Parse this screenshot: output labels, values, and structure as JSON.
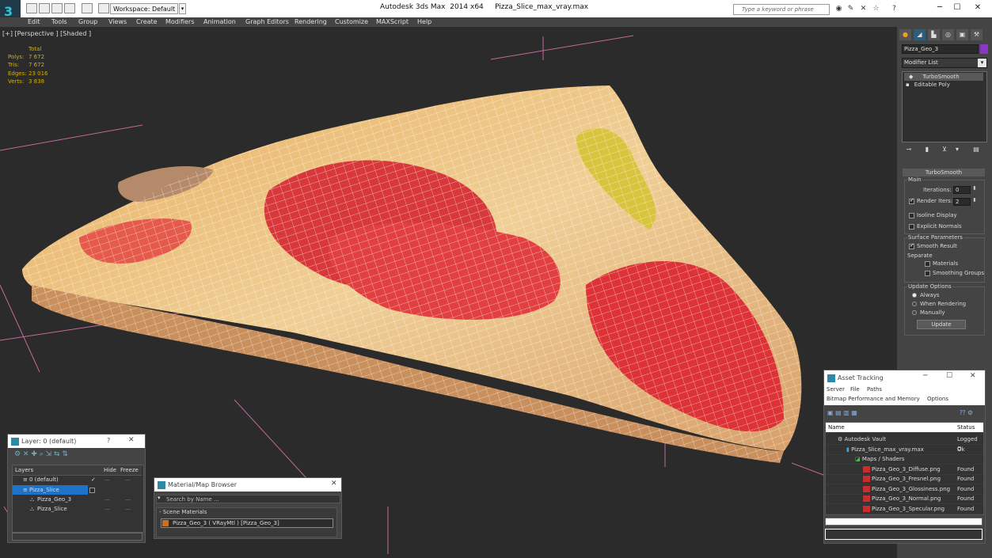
{
  "titlebar": {
    "workspace": "Workspace: Default",
    "app_title": "Autodesk 3ds Max  2014 x64     Pizza_Slice_max_vray.max",
    "search_placeholder": "Type a keyword or phrase"
  },
  "menu": [
    "Edit",
    "Tools",
    "Group",
    "Views",
    "Create",
    "Modifiers",
    "Animation",
    "Graph Editors",
    "Rendering",
    "Customize",
    "MAXScript",
    "Help"
  ],
  "viewport": {
    "label": "[+] [Perspective ] [Shaded ]",
    "stats": {
      "header": "Total",
      "polys_label": "Polys:",
      "polys": "7 672",
      "tris_label": "Tris:",
      "tris": "7 672",
      "edges_label": "Edges:",
      "edges": "23 016",
      "verts_label": "Verts:",
      "verts": "3 838"
    }
  },
  "command_panel": {
    "object_name": "Pizza_Geo_3",
    "object_color": "#8a38c4",
    "modifier_list": "Modifier List",
    "stack": [
      "TurboSmooth",
      "Editable Poly"
    ],
    "rollout_title": "TurboSmooth",
    "main_label": "Main",
    "iterations_label": "Iterations:",
    "iterations_value": "0",
    "render_iters_label": "Render Iters:",
    "render_iters_value": "2",
    "isoline_label": "Isoline Display",
    "explicit_normals_label": "Explicit Normals",
    "surface_params_label": "Surface Parameters",
    "smooth_result_label": "Smooth Result",
    "separate_label": "Separate",
    "materials_label": "Materials",
    "smoothing_groups_label": "Smoothing Groups",
    "update_options_label": "Update Options",
    "always_label": "Always",
    "when_rendering_label": "When Rendering",
    "manually_label": "Manually",
    "update_button": "Update"
  },
  "layer_window": {
    "title": "Layer: 0 (default)",
    "help": "?",
    "columns": {
      "layers": "Layers",
      "hide": "Hide",
      "freeze": "Freeze"
    },
    "rows": [
      {
        "name": "0 (default)"
      },
      {
        "name": "Pizza_Slice"
      },
      {
        "name": "Pizza_Geo_3"
      },
      {
        "name": "Pizza_Slice"
      }
    ]
  },
  "material_browser": {
    "title": "Material/Map Browser",
    "search_placeholder": "Search by Name ...",
    "section": "- Scene Materials",
    "item": "Pizza_Geo_3  ( VRayMtl )  [Pizza_Geo_3]"
  },
  "asset_tracking": {
    "title": "Asset Tracking",
    "menu": [
      "Server",
      "File",
      "Paths"
    ],
    "menu2": [
      "Bitmap Performance and Memory",
      "Options"
    ],
    "columns": {
      "name": "Name",
      "status": "Status"
    },
    "rows": [
      {
        "name": "Autodesk Vault",
        "status": "Logged O"
      },
      {
        "name": "Pizza_Slice_max_vray.max",
        "status": "Ok"
      },
      {
        "name": "Maps / Shaders",
        "status": ""
      },
      {
        "name": "Pizza_Geo_3_Diffuse.png",
        "status": "Found"
      },
      {
        "name": "Pizza_Geo_3_Fresnel.png",
        "status": "Found"
      },
      {
        "name": "Pizza_Geo_3_Glossiness.png",
        "status": "Found"
      },
      {
        "name": "Pizza_Geo_3_Normal.png",
        "status": "Found"
      },
      {
        "name": "Pizza_Geo_3_Specular.png",
        "status": "Found"
      }
    ]
  }
}
